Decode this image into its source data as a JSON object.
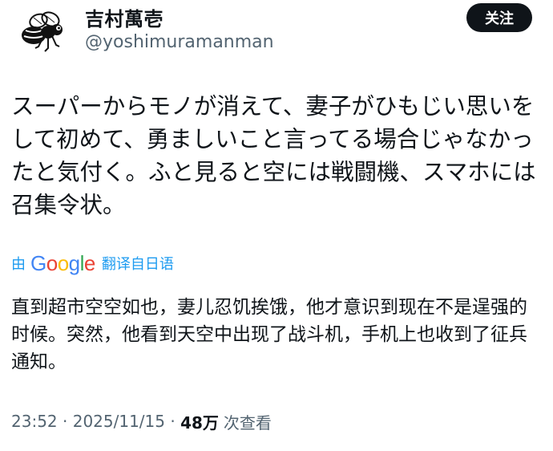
{
  "user": {
    "display_name": "吉村萬壱",
    "handle": "@yoshimuramanman",
    "avatar_icon": "fly-icon"
  },
  "follow_button": {
    "label": "关注"
  },
  "tweet": {
    "text": "スーパーからモノが消えて、妻子がひもじい思いをして初めて、勇ましいこと言ってる場合じゃなかったと気付く。ふと見ると空には戦闘機、スマホには召集令状。"
  },
  "translation": {
    "prefix": "由",
    "service": [
      "G",
      "o",
      "o",
      "g",
      "l",
      "e"
    ],
    "service_colors": [
      "#4285F4",
      "#EA4335",
      "#FBBC05",
      "#4285F4",
      "#34A853",
      "#EA4335"
    ],
    "suffix": "翻译自日语",
    "text": "直到超市空空如也，妻儿忍饥挨饿，他才意识到现在不是逞强的时候。突然，他看到天空中出现了战斗机，手机上也收到了征兵通知。"
  },
  "meta": {
    "time": "23:52",
    "separator": " · ",
    "date": "2025/11/15",
    "views_count": "48万",
    "views_label": "次查看"
  },
  "colors": {
    "link_blue": "#1d9bf0",
    "secondary_text": "#536471",
    "primary_text": "#0f1419"
  }
}
